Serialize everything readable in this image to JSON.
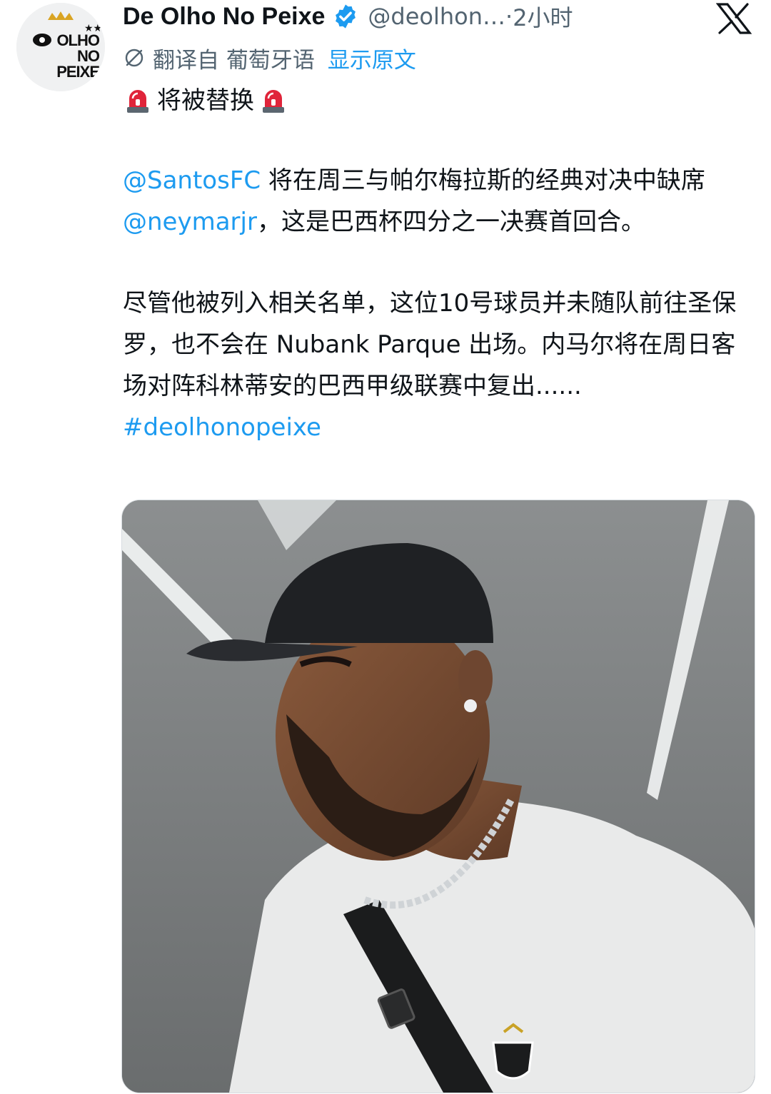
{
  "account": {
    "display_name": "De Olho No Peixe",
    "handle": "@deolhon…",
    "separator": "·",
    "time": "2小时",
    "avatar_logo_text": "OLHO NO PEIXE"
  },
  "translation": {
    "label": "翻译自 葡萄牙语",
    "show_original": "显示原文"
  },
  "post": {
    "title": "将被替换",
    "mention_santos": "@SantosFC",
    "para1_text_a": " 将在周三与帕尔梅拉斯的经典对决中缺席 ",
    "mention_neymar": "@neymarjr",
    "para1_text_b": "，这是巴西杯四分之一决赛首回合。",
    "para2_text": "尽管他被列入相关名单，这位10号球员并未随队前往圣保罗，也不会在 Nubank Parque 出场。内马尔将在周日客场对阵科林蒂安的巴西甲级联赛中复出...... ",
    "hashtag": "#deolhonopeixe"
  },
  "colors": {
    "link": "#1d9bf0",
    "muted": "#536471",
    "text": "#0f1419",
    "siren_red": "#e0243a"
  },
  "icons": {
    "verified": "verified-badge-icon",
    "x": "x-logo-icon",
    "translate": "translate-icon",
    "siren": "police-siren-icon"
  }
}
